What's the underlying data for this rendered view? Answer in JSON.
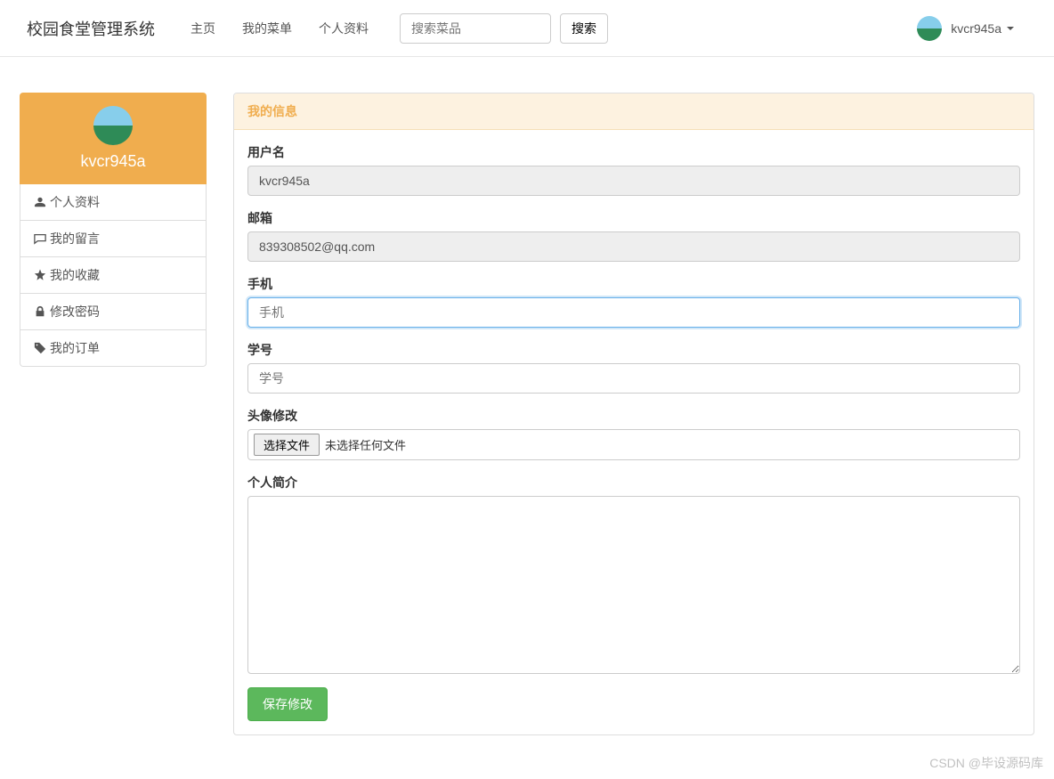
{
  "navbar": {
    "brand": "校园食堂管理系统",
    "links": [
      "主页",
      "我的菜单",
      "个人资料"
    ],
    "search_placeholder": "搜索菜品",
    "search_button": "搜索",
    "username": "kvcr945a"
  },
  "sidebar": {
    "username": "kvcr945a",
    "items": [
      {
        "icon": "user",
        "label": "个人资料"
      },
      {
        "icon": "comment",
        "label": "我的留言"
      },
      {
        "icon": "star",
        "label": "我的收藏"
      },
      {
        "icon": "lock",
        "label": "修改密码"
      },
      {
        "icon": "tag",
        "label": "我的订单"
      }
    ]
  },
  "panel": {
    "title": "我的信息",
    "fields": {
      "username_label": "用户名",
      "username_value": "kvcr945a",
      "email_label": "邮箱",
      "email_value": "839308502@qq.com",
      "phone_label": "手机",
      "phone_placeholder": "手机",
      "student_id_label": "学号",
      "student_id_placeholder": "学号",
      "avatar_label": "头像修改",
      "file_button": "选择文件",
      "file_status": "未选择任何文件",
      "bio_label": "个人简介",
      "submit": "保存修改"
    }
  },
  "watermark": "CSDN @毕设源码库"
}
